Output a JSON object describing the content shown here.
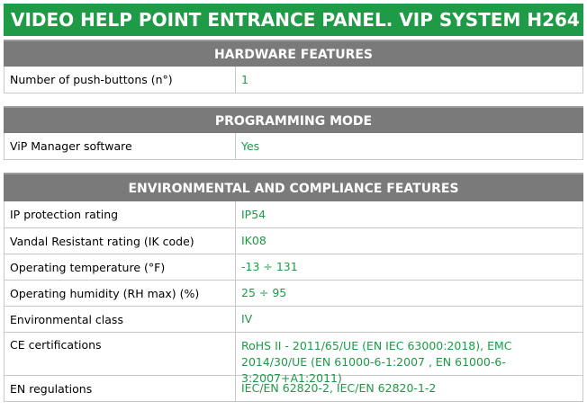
{
  "title": "VIDEO HELP POINT ENTRANCE PANEL. VIP SYSTEM H264",
  "sections": [
    {
      "header": "HARDWARE FEATURES",
      "rows": [
        {
          "label": "Number of push-buttons (n°)",
          "value": "1"
        }
      ]
    },
    {
      "header": "PROGRAMMING MODE",
      "rows": [
        {
          "label": "ViP Manager software",
          "value": "Yes"
        }
      ]
    },
    {
      "header": "ENVIRONMENTAL AND COMPLIANCE FEATURES",
      "rows": [
        {
          "label": "IP protection rating",
          "value": "IP54"
        },
        {
          "label": "Vandal Resistant rating (IK code)",
          "value": "IK08"
        },
        {
          "label": "Operating temperature (°F)",
          "value": "-13 ÷ 131"
        },
        {
          "label": "Operating humidity (RH max) (%)",
          "value": "25 ÷ 95"
        },
        {
          "label": "Environmental class",
          "value": "IV"
        },
        {
          "label": "CE certifications",
          "value": "RoHS II - 2011/65/UE (EN IEC 63000:2018), EMC 2014/30/UE (EN 61000-6-1:2007 , EN 61000-6-3:2007+A1:2011)"
        },
        {
          "label": "EN regulations",
          "value": "IEC/EN 62820-2, IEC/EN 62820-1-2"
        }
      ]
    }
  ]
}
